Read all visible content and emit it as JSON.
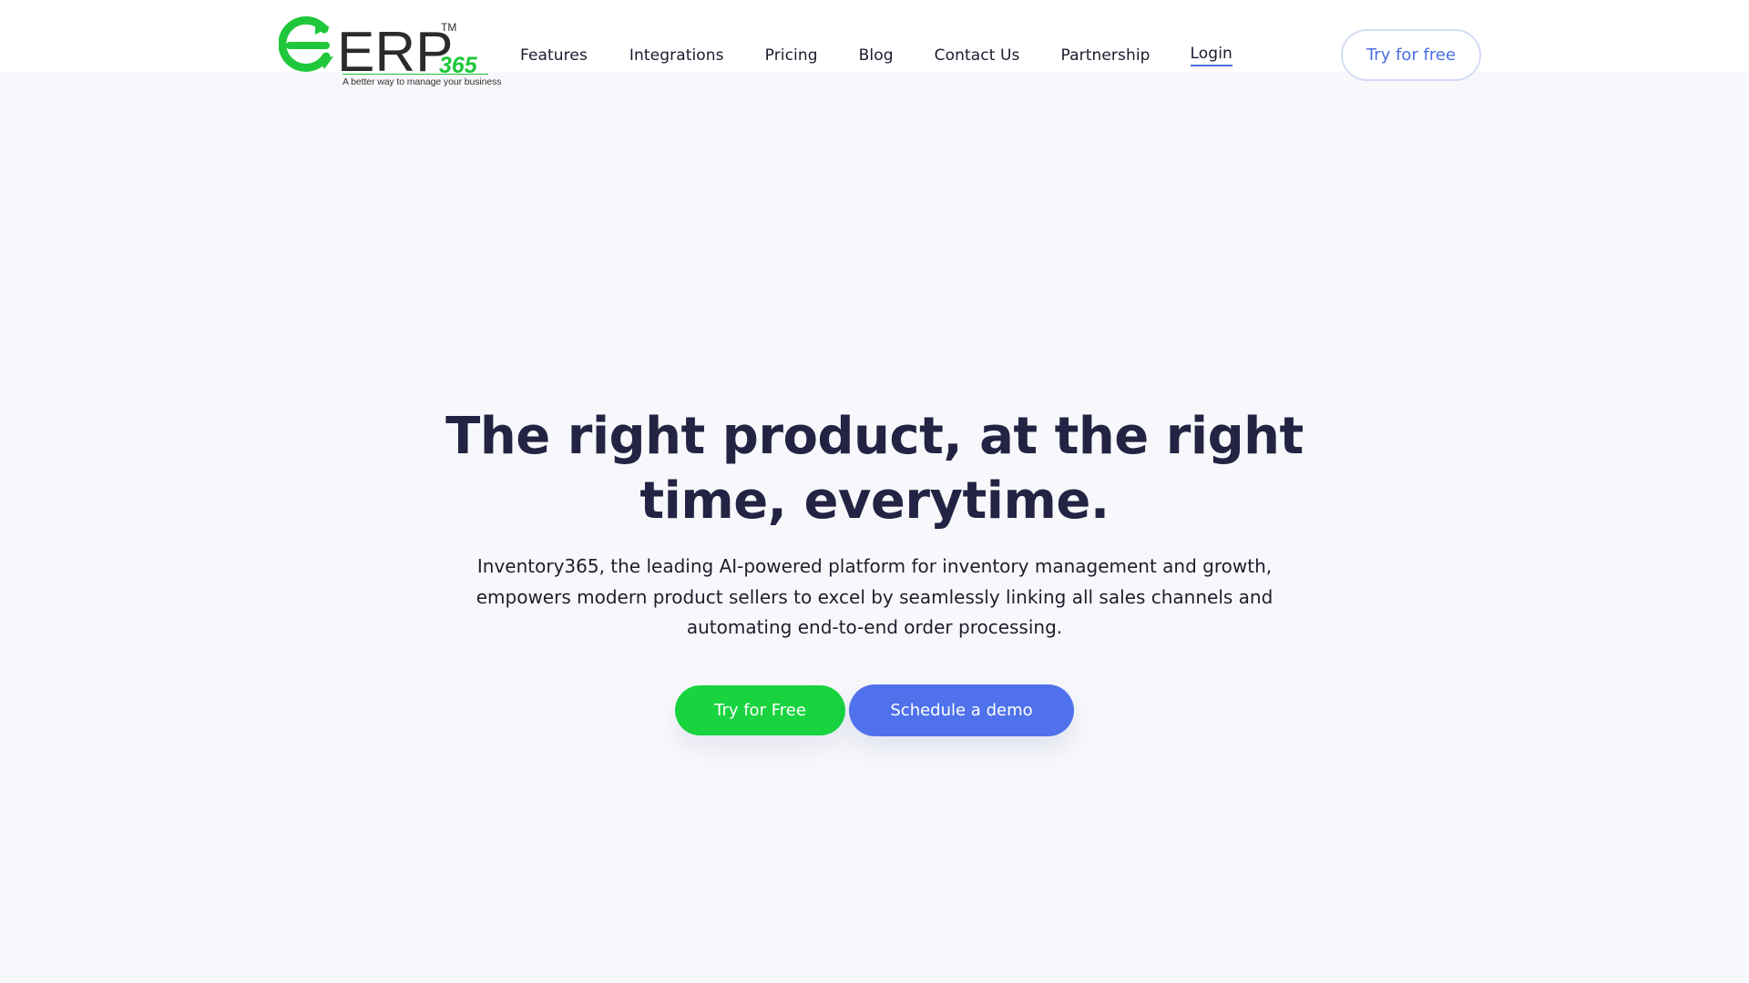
{
  "brand": {
    "tagline": "A better way to manage your business",
    "primary_color": "#19d33f",
    "accent_color": "#4f72ec",
    "text_color": "#232443"
  },
  "nav": {
    "items": [
      {
        "label": "Features"
      },
      {
        "label": "Integrations"
      },
      {
        "label": "Pricing"
      },
      {
        "label": "Blog"
      },
      {
        "label": "Contact Us"
      },
      {
        "label": "Partnership"
      },
      {
        "label": "Login"
      }
    ],
    "cta_label": "Try for free"
  },
  "hero": {
    "title_line1": "The right product, at the right",
    "title_line2": "time, everytime.",
    "desc_line1": "Inventory365, the leading AI-powered platform for inventory management and growth,",
    "desc_line2": "empowers modern product sellers to excel by seamlessly linking all sales channels and",
    "desc_line3": "automating end-to-end order processing.",
    "primary_button": "Try for Free",
    "secondary_button": "Schedule a demo"
  }
}
